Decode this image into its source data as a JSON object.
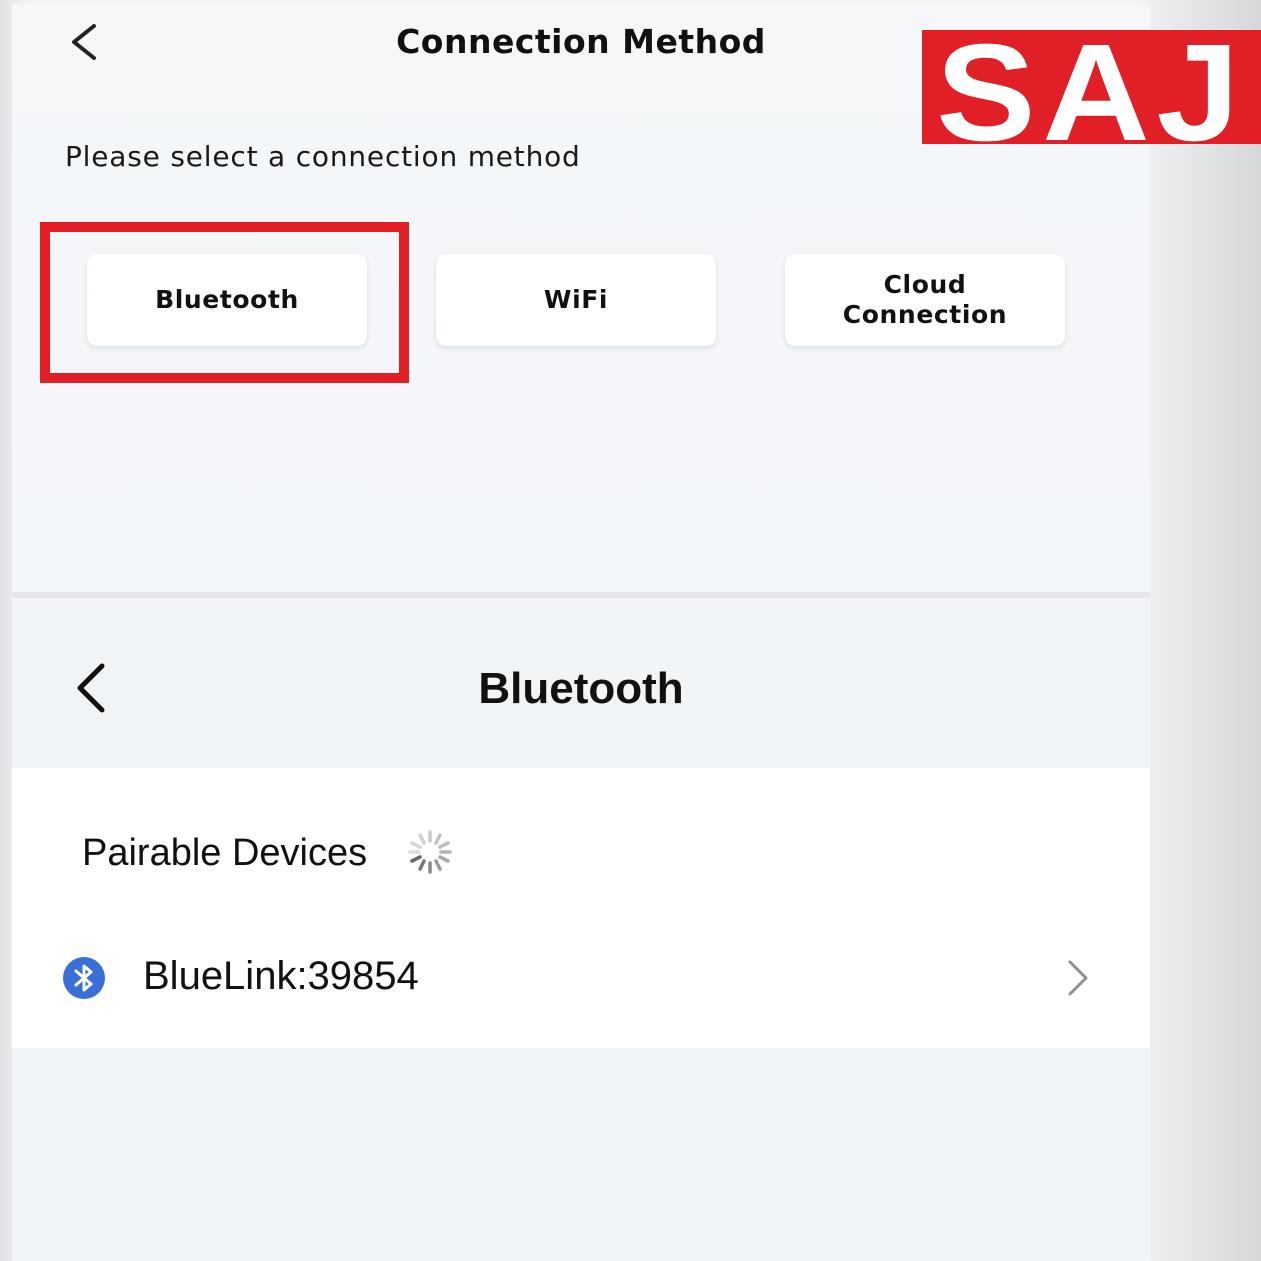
{
  "connection_screen": {
    "title": "Connection Method",
    "prompt": "Please select a connection method",
    "methods": [
      {
        "label": "Bluetooth"
      },
      {
        "label": "WiFi"
      },
      {
        "label": "Cloud Connection"
      }
    ],
    "highlight_color": "#e11f26"
  },
  "logo": {
    "text": "SAJ",
    "color": "#e11f26"
  },
  "bluetooth_screen": {
    "title": "Bluetooth",
    "section_label": "Pairable Devices",
    "devices": [
      {
        "name": "BlueLink:39854"
      }
    ],
    "accent": "#3a6fd8"
  },
  "icons": [
    "back-arrow-icon",
    "loading-spinner-icon",
    "bluetooth-icon",
    "chevron-right-icon"
  ]
}
